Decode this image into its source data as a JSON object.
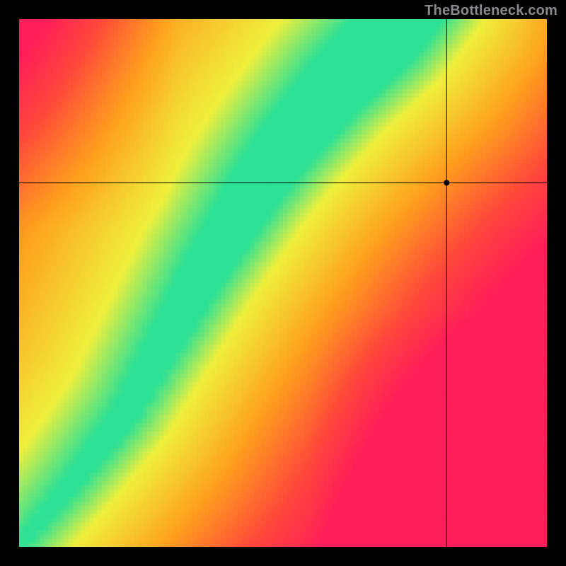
{
  "watermark_text": "TheBottleneck.com",
  "crosshair": {
    "x_frac": 0.81,
    "y_frac": 0.31
  },
  "chart_data": {
    "type": "heatmap",
    "title": "",
    "xlabel": "",
    "ylabel": "",
    "xlim": [
      0,
      1
    ],
    "ylim": [
      0,
      1
    ],
    "grid_resolution": 128,
    "colorscale_description": "red → orange → yellow → green diverging (green = optimal)",
    "curve_points": [
      [
        0.0,
        0.0
      ],
      [
        0.1,
        0.12
      ],
      [
        0.2,
        0.25
      ],
      [
        0.25,
        0.34
      ],
      [
        0.3,
        0.43
      ],
      [
        0.35,
        0.52
      ],
      [
        0.4,
        0.6
      ],
      [
        0.45,
        0.68
      ],
      [
        0.5,
        0.75
      ],
      [
        0.55,
        0.81
      ],
      [
        0.6,
        0.87
      ],
      [
        0.65,
        0.92
      ],
      [
        0.7,
        0.97
      ],
      [
        0.72,
        1.0
      ]
    ],
    "band_width_bottom": 0.01,
    "band_width_top": 0.07,
    "crosshair_point": {
      "x": 0.81,
      "y": 0.69
    },
    "legend": []
  }
}
